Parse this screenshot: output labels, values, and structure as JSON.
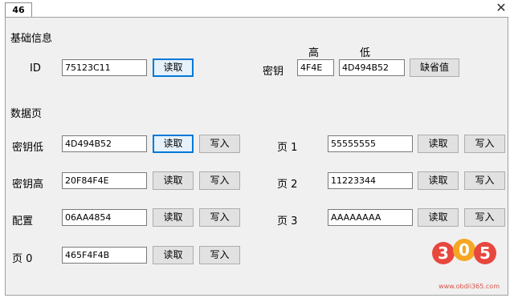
{
  "tab": {
    "label": "46"
  },
  "basic": {
    "title": "基础信息",
    "id_label": "ID",
    "id_value": "75123C11",
    "read_label": "读取",
    "key_label": "密钥",
    "key_high_header": "高",
    "key_low_header": "低",
    "key_high_value": "4F4E",
    "key_low_value": "4D494B52",
    "default_label": "缺省值"
  },
  "data": {
    "title": "数据页",
    "read_label": "读取",
    "write_label": "写入",
    "left_rows": [
      {
        "label": "密钥低",
        "value": "4D494B52"
      },
      {
        "label": "密钥高",
        "value": "20F84F4E"
      },
      {
        "label": "配置",
        "value": "06AA4854"
      },
      {
        "label": "页 0",
        "value": "465F4F4B"
      }
    ],
    "right_rows": [
      {
        "label": "页 1",
        "value": "55555555"
      },
      {
        "label": "页 2",
        "value": "11223344"
      },
      {
        "label": "页 3",
        "value": "AAAAAAAA"
      }
    ]
  },
  "watermark": {
    "digits": "305",
    "url": "www.obdii365.com"
  },
  "colors": {
    "focus_border": "#0078d7",
    "panel_bg": "#f0f0f0",
    "watermark_red": "#e8473e",
    "watermark_orange": "#f5a623"
  }
}
